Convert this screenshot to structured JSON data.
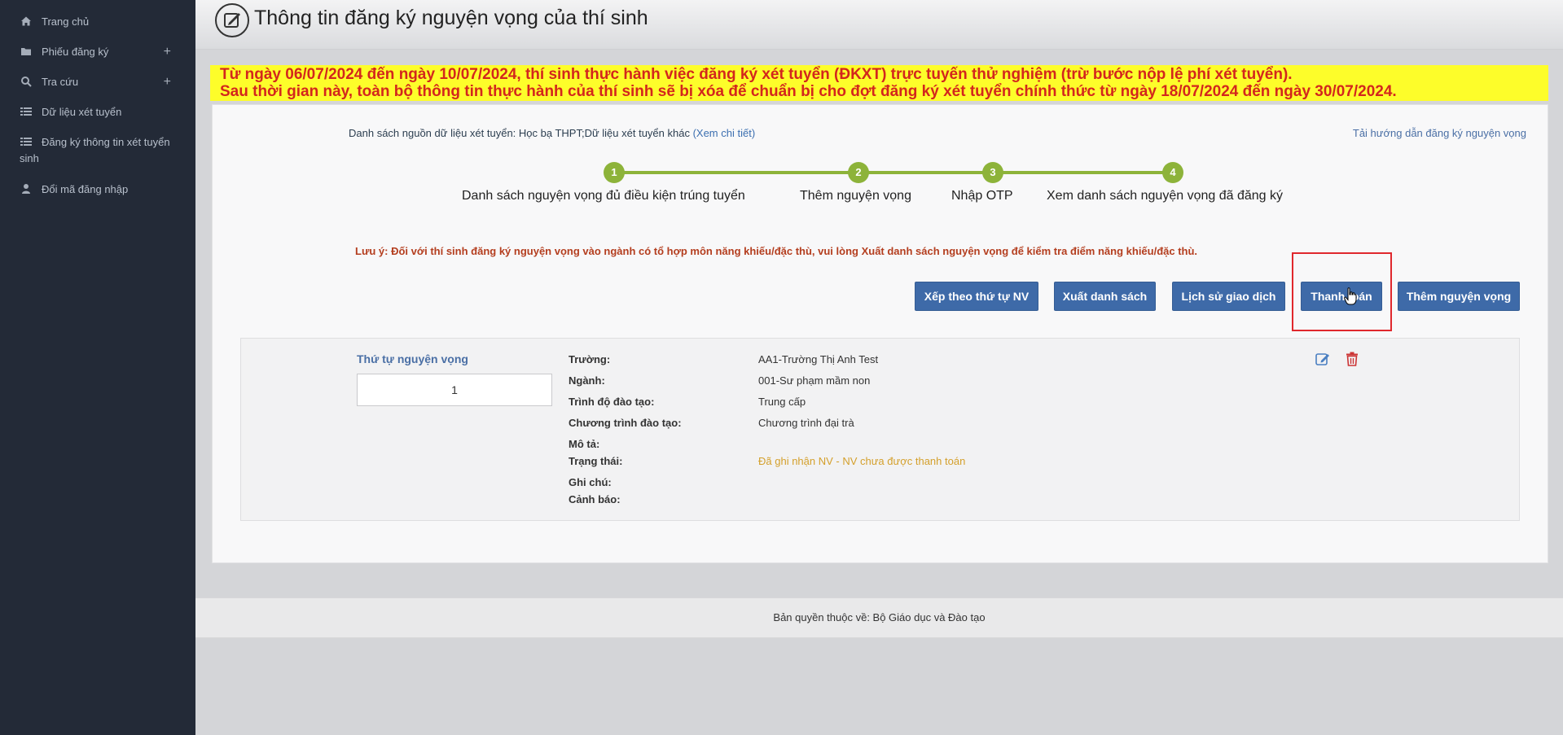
{
  "sidebar": {
    "items": [
      {
        "label": "Trang chủ",
        "icon": "home-icon"
      },
      {
        "label": "Phiếu đăng ký",
        "icon": "folder-icon",
        "expand": "+"
      },
      {
        "label": "Tra cứu",
        "icon": "search-icon",
        "expand": "+"
      },
      {
        "label": "Dữ liệu xét tuyển",
        "icon": "list-icon"
      },
      {
        "label": "Đăng ký thông tin xét tuyển",
        "label2": "sinh",
        "icon": "list-icon"
      },
      {
        "label": "Đổi mã đăng nhập",
        "icon": "user-icon"
      }
    ]
  },
  "header": {
    "title": "Thông tin đăng ký nguyện vọng của thí sinh"
  },
  "banner": {
    "line1": "Từ ngày 06/07/2024 đến ngày 10/07/2024, thí sinh thực hành việc đăng ký xét tuyển (ĐKXT) trực tuyến thử nghiệm (trừ bước nộp lệ phí xét tuyển).",
    "line2": "Sau thời gian này, toàn bộ thông tin thực hành của thí sinh sẽ bị xóa để chuẩn bị cho đợt đăng ký xét tuyển chính thức từ ngày 18/07/2024 đến ngày 30/07/2024."
  },
  "main": {
    "source_text": "Danh sách nguồn dữ liệu xét tuyển: Học bạ THPT;Dữ liệu xét tuyển khác ",
    "source_link": "(Xem chi tiết)",
    "guide_link": "Tải hướng dẫn đăng ký nguyện vọng",
    "steps": [
      {
        "num": "1",
        "label": "Danh sách nguyện vọng đủ điều kiện trúng tuyển"
      },
      {
        "num": "2",
        "label": "Thêm nguyện vọng"
      },
      {
        "num": "3",
        "label": "Nhập OTP"
      },
      {
        "num": "4",
        "label": "Xem danh sách nguyện vọng đã đăng ký"
      }
    ],
    "note": "Lưu ý: Đối với thí sinh đăng ký nguyện vọng vào ngành có tổ hợp môn năng khiếu/đặc thù, vui lòng Xuất danh sách nguyện vọng để kiểm tra điểm năng khiếu/đặc thù.",
    "buttons": {
      "sort": "Xếp theo thứ tự NV",
      "export": "Xuất danh sách",
      "history": "Lịch sử giao dịch",
      "pay": "Thanh toán",
      "add": "Thêm nguyện vọng"
    },
    "record": {
      "order_label": "Thứ tự nguyện vọng",
      "order_value": "1",
      "fields": [
        {
          "label": "Trường:",
          "value": "AA1-Trường Thị Anh Test"
        },
        {
          "label": "Ngành:",
          "value": "001-Sư phạm mầm non"
        },
        {
          "label": "Trình độ đào tạo:",
          "value": "Trung cấp"
        },
        {
          "label": "Chương trình đào tạo:",
          "value": "Chương trình đại trà"
        },
        {
          "label": "Mô tả:",
          "value": ""
        },
        {
          "label": "Trạng thái:",
          "value": "Đã ghi nhận NV - NV chưa được thanh toán"
        },
        {
          "label": "Ghi chú:",
          "value": ""
        },
        {
          "label": "Cảnh báo:",
          "value": ""
        }
      ]
    }
  },
  "footer": {
    "text": "Bản quyền thuộc về: Bộ Giáo dục và Đào tạo"
  },
  "colors": {
    "sidebar": "#232a37",
    "banner": "#fdfd2a",
    "banner_text": "#d3261d",
    "button": "#3e6aa8",
    "step": "#8db33a",
    "status": "#d4a02c",
    "highlight": "#e0282d"
  }
}
